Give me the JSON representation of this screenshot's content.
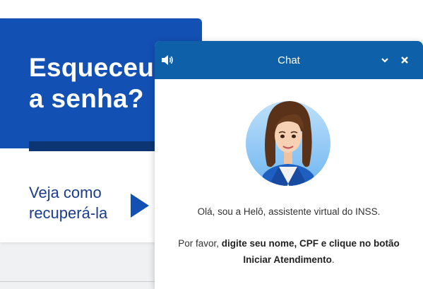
{
  "promo": {
    "title": "Esqueceu\na senha?",
    "link_text": "Veja como\nrecuperá-la",
    "icon": "play-arrow-icon"
  },
  "chat": {
    "title": "Chat",
    "icons": {
      "sound": "speaker-icon",
      "minimize": "chevron-down-icon",
      "close": "close-icon"
    },
    "greeting": "Olá, sou a Helô, assistente virtual do INSS.",
    "instruction": {
      "prefix": "Por favor, ",
      "bold1": "digite seu nome, CPF e clique no botão",
      "bold2": "Iniciar Atendimento",
      "suffix": "."
    }
  },
  "colors": {
    "promo_blue": "#1350b4",
    "promo_bar": "#0c3573",
    "chat_header": "#0e60a8",
    "link_text": "#1a3d8c"
  }
}
